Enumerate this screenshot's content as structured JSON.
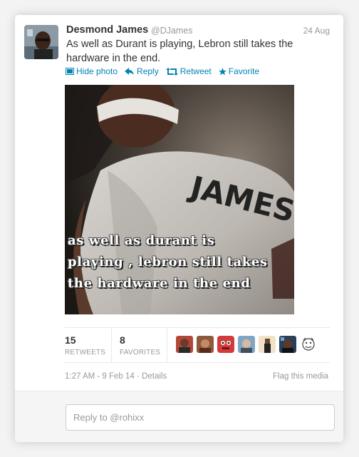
{
  "tweet": {
    "name": "Desmond James",
    "handle": "@DJames",
    "date": "24 Aug",
    "text": "As well as Durant is playing, Lebron still takes the hardware in the end.",
    "actions": {
      "hide_photo": "Hide photo",
      "reply": "Reply",
      "retweet": "Retweet",
      "favorite": "Favorite"
    }
  },
  "media": {
    "jersey_text": "JAMES",
    "caption_lines": [
      "as well as durant is",
      "playing , lebron still takes",
      "the hardware in the end"
    ]
  },
  "stats": {
    "retweets_count": "15",
    "retweets_label": "RETWEETS",
    "favorites_count": "8",
    "favorites_label": "FAVORITES"
  },
  "meta": {
    "timestamp": "1:27 AM - 9 Feb 14",
    "separator": "·",
    "details": "Details",
    "flag": "Flag this media"
  },
  "reply": {
    "placeholder": "Reply to @rohixx"
  },
  "colors": {
    "link": "#0084b4",
    "muted": "#999999",
    "text": "#333333"
  }
}
